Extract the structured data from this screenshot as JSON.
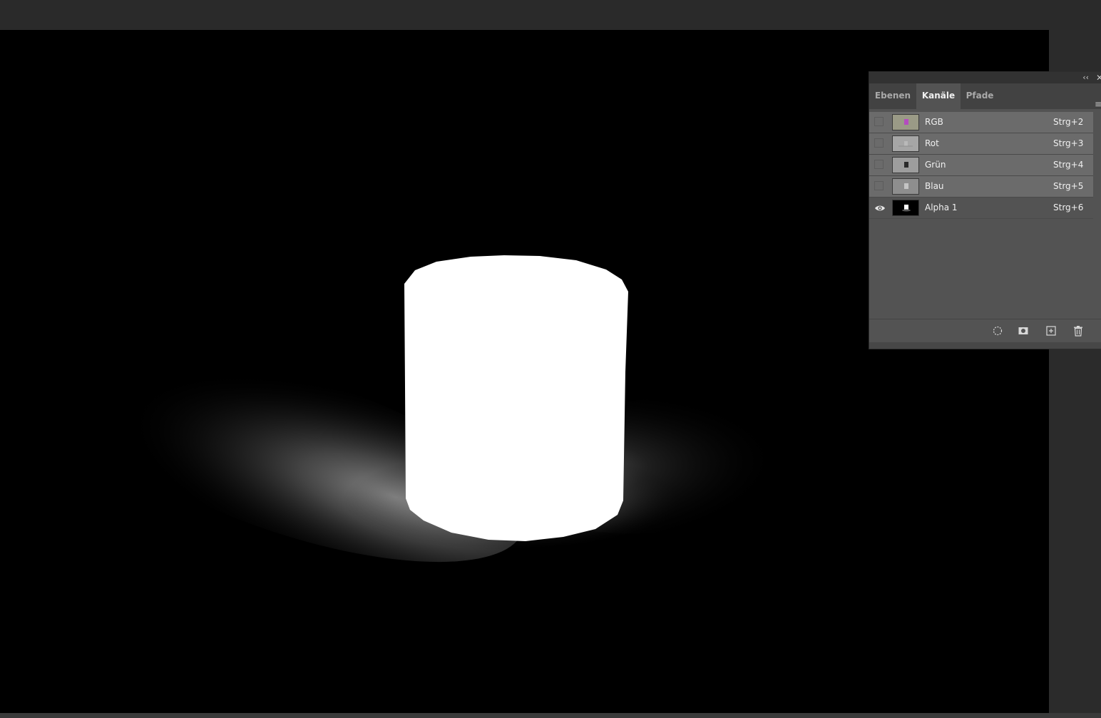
{
  "panel": {
    "collapse_glyph": "‹‹",
    "close_glyph": "✕",
    "menu_glyph": "≡",
    "tabs": [
      {
        "label": "Ebenen",
        "active": false
      },
      {
        "label": "Kanäle",
        "active": true
      },
      {
        "label": "Pfade",
        "active": false
      }
    ],
    "channels": [
      {
        "name": "RGB",
        "shortcut": "Strg+2",
        "visible": false,
        "thumb": "rgb-thumbnail"
      },
      {
        "name": "Rot",
        "shortcut": "Strg+3",
        "visible": false,
        "thumb": "red-thumbnail"
      },
      {
        "name": "Grün",
        "shortcut": "Strg+4",
        "visible": false,
        "thumb": "green-thumbnail"
      },
      {
        "name": "Blau",
        "shortcut": "Strg+5",
        "visible": false,
        "thumb": "blue-thumbnail"
      },
      {
        "name": "Alpha 1",
        "shortcut": "Strg+6",
        "visible": true,
        "thumb": "alpha-thumbnail"
      }
    ],
    "footer_icons": [
      "load-selection-icon",
      "save-selection-icon",
      "new-channel-icon",
      "trash-icon"
    ]
  },
  "colors": {
    "panel_bg": "#535353",
    "selected_row": "#6b6b6b",
    "canvas_bg": "#000000",
    "app_bg": "#282828"
  }
}
